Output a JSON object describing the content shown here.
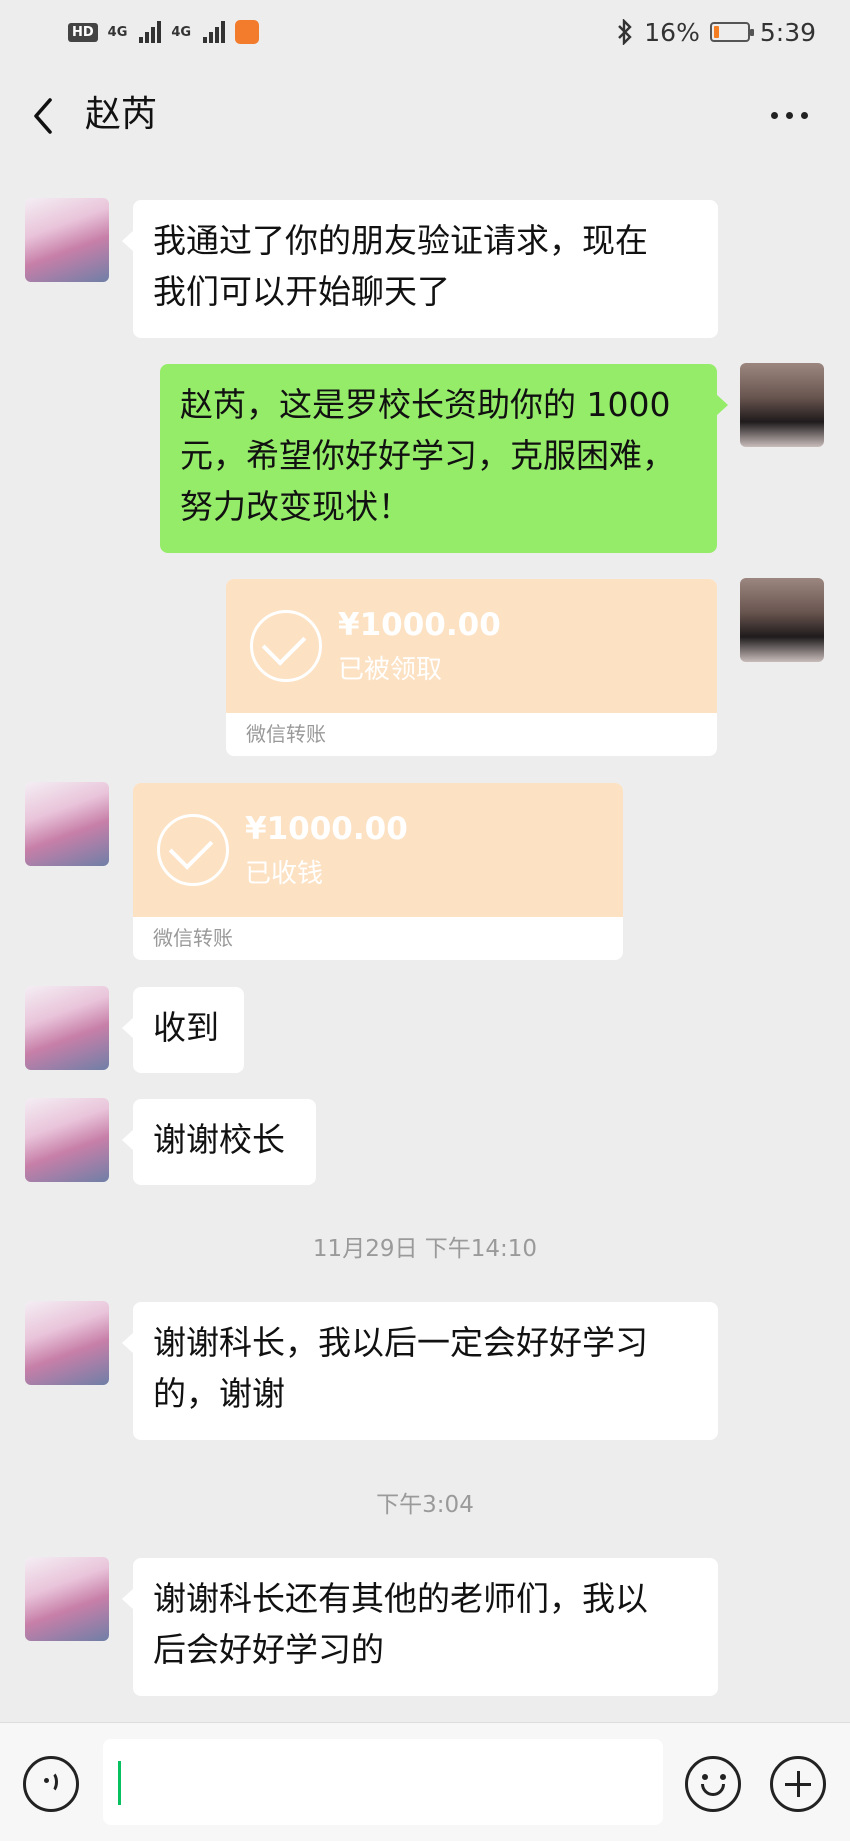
{
  "status_bar": {
    "hd": "HD",
    "signal1": "4G",
    "signal2": "4G",
    "battery_pct": "16%",
    "battery_level": 0.16,
    "time": "5:39"
  },
  "nav": {
    "title": "赵芮"
  },
  "messages": [
    {
      "side": "left",
      "text": "我通过了你的朋友验证请求，现在\n我们可以开始聊天了"
    },
    {
      "side": "right",
      "text": "赵芮，这是罗校长资助你的 1000\n元，希望你好好学习，克服困难，\n努力改变现状！"
    },
    {
      "side": "right",
      "amount": "¥1000.00",
      "status": "已被领取",
      "footer": "微信转账"
    },
    {
      "side": "left",
      "amount": "¥1000.00",
      "status": "已收钱",
      "footer": "微信转账"
    },
    {
      "side": "left",
      "text": "收到"
    },
    {
      "side": "left",
      "text": "谢谢校长"
    },
    {
      "side": "left",
      "text": "谢谢科长，我以后一定会好好学习\n的，谢谢"
    },
    {
      "side": "left",
      "text": "谢谢科长还有其他的老师们，我以\n后会好好学习的"
    }
  ],
  "timestamps": [
    "11月29日 下午14:10",
    "下午3:04"
  ],
  "input": {
    "value": ""
  }
}
